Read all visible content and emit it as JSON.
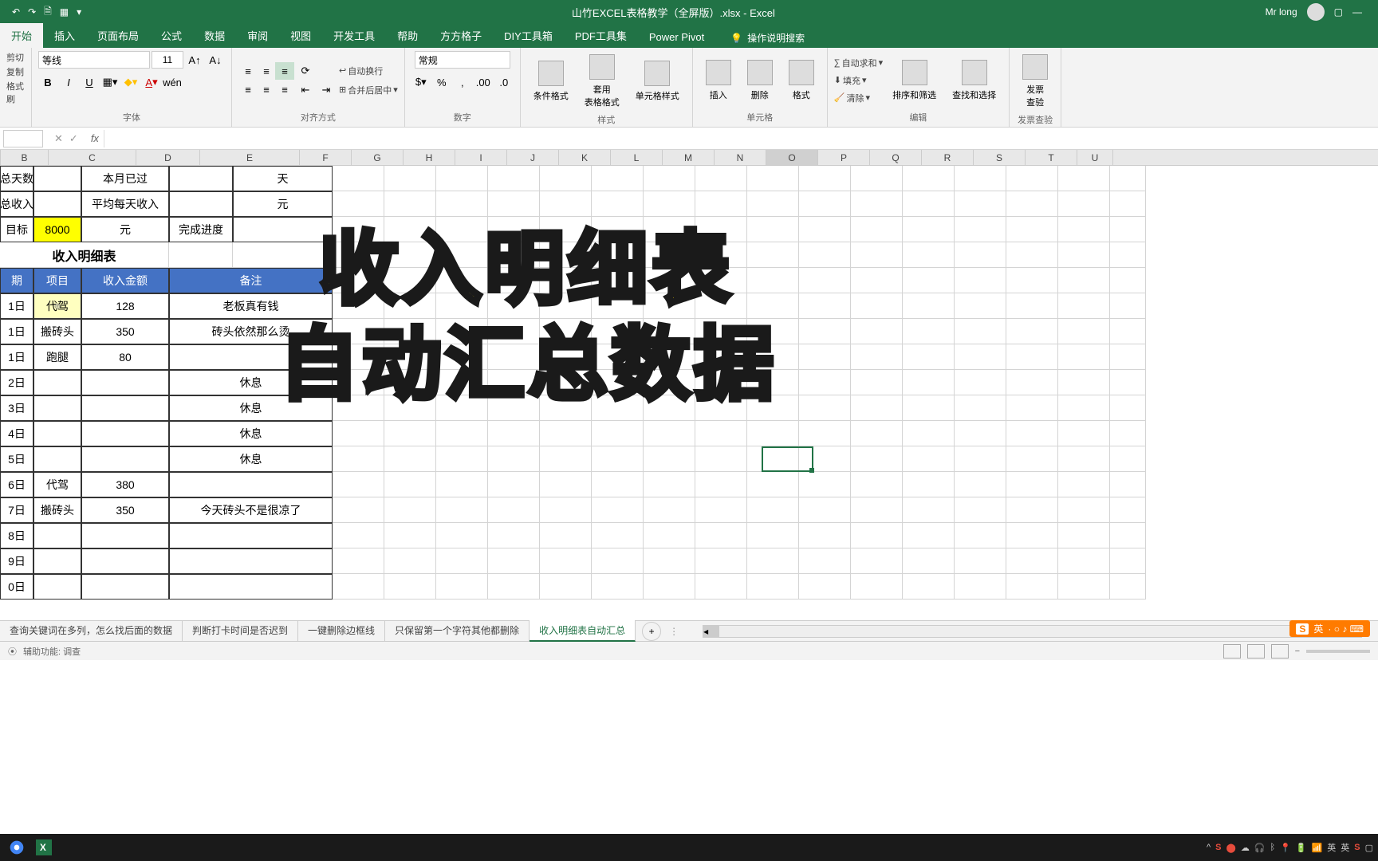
{
  "titlebar": {
    "title": "山竹EXCEL表格教学（全屏版）.xlsx - Excel",
    "user": "Mr long"
  },
  "tabs": {
    "start": "开始",
    "insert": "插入",
    "layout": "页面布局",
    "formula": "公式",
    "data": "数据",
    "review": "审阅",
    "view": "视图",
    "dev": "开发工具",
    "help": "帮助",
    "fang": "方方格子",
    "diy": "DIY工具箱",
    "pdf": "PDF工具集",
    "pivot": "Power Pivot",
    "tellme": "操作说明搜索"
  },
  "ribbon": {
    "clipboard": {
      "cut": "剪切",
      "copy": "复制",
      "paint": "格式刷",
      "label": ""
    },
    "font": {
      "name": "等线",
      "size": "11",
      "label": "字体"
    },
    "align": {
      "wrap": "自动换行",
      "merge": "合并后居中",
      "label": "对齐方式"
    },
    "number": {
      "format": "常规",
      "label": "数字"
    },
    "styles": {
      "cond": "条件格式",
      "table": "套用\n表格格式",
      "cell": "单元格样式",
      "label": "样式"
    },
    "cells": {
      "insert": "插入",
      "delete": "删除",
      "format": "格式",
      "label": "单元格"
    },
    "editing": {
      "sum": "自动求和",
      "fill": "填充",
      "clear": "清除",
      "sort": "排序和筛选",
      "find": "查找和选择",
      "label": "编辑"
    },
    "invoice": {
      "check": "发票\n查验",
      "label": "发票查验"
    }
  },
  "columns": [
    "B",
    "C",
    "D",
    "E",
    "F",
    "G",
    "H",
    "I",
    "J",
    "K",
    "L",
    "M",
    "N",
    "O",
    "P",
    "Q",
    "R",
    "S",
    "T",
    "U"
  ],
  "colWidths": {
    "B": 60,
    "C": 110,
    "D": 80,
    "E": 125,
    "F": 65,
    "G": 65,
    "H": 65,
    "I": 65,
    "J": 65,
    "K": 65,
    "L": 65,
    "M": 65,
    "N": 65,
    "O": 65,
    "P": 65,
    "Q": 65,
    "R": 65,
    "S": 65,
    "T": 65,
    "U": 45
  },
  "summary": {
    "a_col": [
      "总天数",
      "总收入",
      "目标"
    ],
    "c2": "本月已过",
    "e2": "天",
    "c3": "平均每天收入",
    "e3": "元",
    "b4": "8000",
    "c4": "元",
    "d4": "完成进度"
  },
  "table": {
    "title": "收入明细表",
    "headers": {
      "a": "期",
      "b": "项目",
      "c": "收入金额",
      "d": "备注"
    },
    "rows": [
      {
        "a": "1日",
        "b": "代驾",
        "c": "128",
        "d": "老板真有钱",
        "hl": true
      },
      {
        "a": "1日",
        "b": "搬砖头",
        "c": "350",
        "d": "砖头依然那么烫"
      },
      {
        "a": "1日",
        "b": "跑腿",
        "c": "80",
        "d": ""
      },
      {
        "a": "2日",
        "b": "",
        "c": "",
        "d": "休息"
      },
      {
        "a": "3日",
        "b": "",
        "c": "",
        "d": "休息"
      },
      {
        "a": "4日",
        "b": "",
        "c": "",
        "d": "休息"
      },
      {
        "a": "5日",
        "b": "",
        "c": "",
        "d": "休息"
      },
      {
        "a": "6日",
        "b": "代驾",
        "c": "380",
        "d": ""
      },
      {
        "a": "7日",
        "b": "搬砖头",
        "c": "350",
        "d": "今天砖头不是很凉了"
      },
      {
        "a": "8日",
        "b": "",
        "c": "",
        "d": ""
      },
      {
        "a": "9日",
        "b": "",
        "c": "",
        "d": ""
      },
      {
        "a": "0日",
        "b": "",
        "c": "",
        "d": ""
      }
    ]
  },
  "overlay": {
    "line1": "收入明细表",
    "line2": "自动汇总数据"
  },
  "sheetTabs": [
    "查询关键词在多列，怎么找后面的数据",
    "判断打卡时间是否迟到",
    "一键删除边框线",
    "只保留第一个字符其他都删除",
    "收入明细表自动汇总"
  ],
  "statusbar": {
    "help": "辅助功能: 调查"
  },
  "badge": {
    "text": "英",
    "icons": "· ○ ♪ ⌨"
  }
}
